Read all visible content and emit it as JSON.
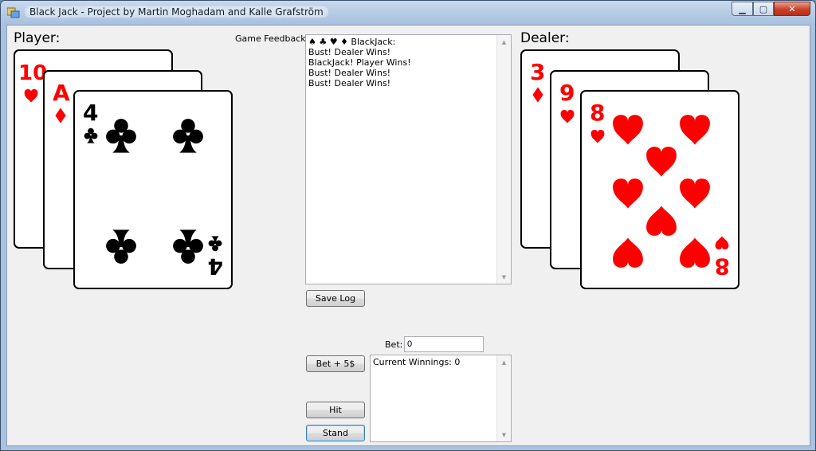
{
  "window": {
    "title": "Black Jack - Project by Martin Moghadam and Kalle Grafström",
    "icon": "app-icon"
  },
  "labels": {
    "player": "Player:",
    "dealer": "Dealer:",
    "game_feedback": "Game Feedback:",
    "bet": "Bet:"
  },
  "feedback_log": [
    "♠ ♣ ♥ ♦ BlackJack:",
    "Bust! Dealer Wins!",
    "BlackJack! Player Wins!",
    "Bust! Dealer Wins!",
    "Bust! Dealer Wins!"
  ],
  "winnings_log": [
    "Current Winnings: 0"
  ],
  "bet_value": "0",
  "buttons": {
    "save_log": "Save Log",
    "bet_plus": "Bet + 5$",
    "hit": "Hit",
    "stand": "Stand"
  },
  "player_cards": [
    {
      "rank": "10",
      "suit": "hearts"
    },
    {
      "rank": "A",
      "suit": "diamonds"
    },
    {
      "rank": "4",
      "suit": "clubs"
    }
  ],
  "dealer_cards": [
    {
      "rank": "3",
      "suit": "diamonds"
    },
    {
      "rank": "9",
      "suit": "hearts"
    },
    {
      "rank": "8",
      "suit": "hearts"
    }
  ],
  "colors": {
    "red_suit": "#ff0000",
    "black_suit": "#000000"
  }
}
